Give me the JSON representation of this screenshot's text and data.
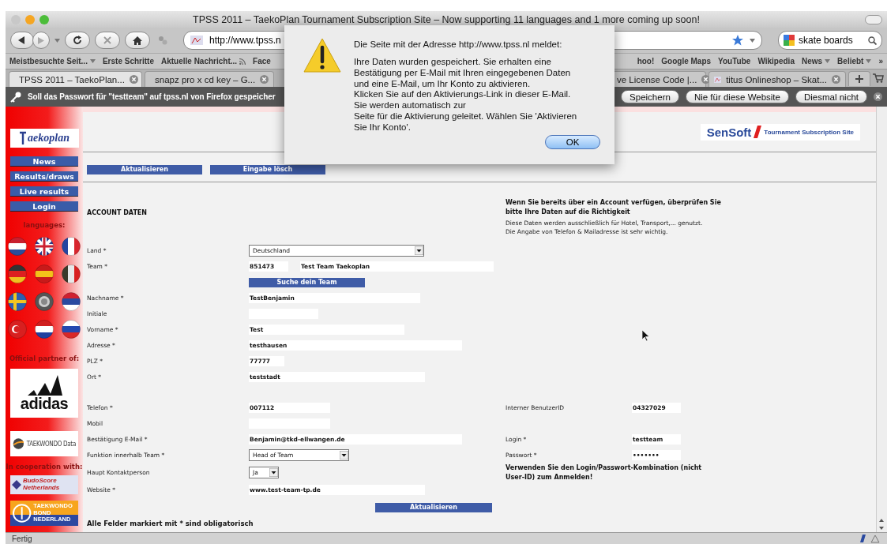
{
  "window": {
    "title": "TPSS 2011 – TaekoPlan Tournament Subscription Site – Now supporting 11 languages and 1 more coming up soon!"
  },
  "toolbar": {
    "url": "http://www.tpss.n",
    "search": {
      "value": "skate boards"
    }
  },
  "bookmarks_left": [
    {
      "label": "Meistbesuchte Seit...",
      "kind": "menu"
    },
    {
      "label": "Erste Schritte",
      "kind": "link"
    },
    {
      "label": "Aktuelle Nachricht...",
      "kind": "feed"
    },
    {
      "label": "Face",
      "kind": "link"
    }
  ],
  "bookmarks_right": [
    {
      "label": "hoo!",
      "kind": "link"
    },
    {
      "label": "Google Maps",
      "kind": "link"
    },
    {
      "label": "YouTube",
      "kind": "link"
    },
    {
      "label": "Wikipedia",
      "kind": "link"
    },
    {
      "label": "News",
      "kind": "menu"
    },
    {
      "label": "Beliebt",
      "kind": "menu"
    },
    {
      "label": "»",
      "kind": "link"
    }
  ],
  "tabs_left": [
    {
      "label": "TPSS 2011 – TaekoPlan...",
      "selected": true
    },
    {
      "label": "snapz pro x cd key – G...",
      "selected": false
    }
  ],
  "tabs_right": [
    {
      "label": "ve License Code |...",
      "selected": false
    },
    {
      "label": "titus Onlineshop – Skat...",
      "selected": false
    }
  ],
  "password_bar": {
    "message": "Soll das Passwort für \"testteam\" auf tpss.nl von Firefox gespeicher",
    "buttons": [
      "Speichern",
      "Nie für diese Website",
      "Diesmal nicht"
    ]
  },
  "sidebar": {
    "logo": "aekoplan",
    "nav": [
      "News",
      "Results/draws",
      "Live results",
      "Login"
    ],
    "languages_label": "languages:",
    "partner_label": "Official partner of:",
    "partner_logos": [
      "adidas",
      "TAEKWONDO Data"
    ],
    "cooperation_label": "In cooperation with:",
    "cooperation_logos": [
      "BudoScore Netherlands",
      "TAEKWONDO BOND NEDERLAND"
    ]
  },
  "header_logo": {
    "brand": "SenSoft",
    "tagline": "Tournament Subscription Site"
  },
  "top_buttons": [
    "Aktualisieren",
    "Eingabe lösch"
  ],
  "section_title": "ACCOUNT DATEN",
  "info": {
    "heading": "Wenn Sie bereits über ein Account verfügen, überprüfen Sie\nbitte Ihre Daten auf die Richtigkeit",
    "text": "Diese Daten werden ausschließlich für Hotel, Transport,... genutzt.\nDie Angabe von Telefon & Mailadresse ist sehr wichtig."
  },
  "address_rows": [
    {
      "label": "Land *",
      "kind": "select",
      "value": "Deutschland"
    },
    {
      "label": "Team *",
      "kind": "pair",
      "values": [
        "851473",
        "Test Team Taekoplan"
      ]
    },
    {
      "kind": "button",
      "value": "Suche dein Team"
    },
    {
      "label": "Nachname *",
      "kind": "text",
      "value": "TestBenjamin"
    },
    {
      "label": "Initiale",
      "kind": "text"
    },
    {
      "label": "Vorname *",
      "kind": "text",
      "value": "Test"
    },
    {
      "label": "Adresse *",
      "kind": "text",
      "value": "testhausen"
    },
    {
      "label": "PLZ *",
      "kind": "text",
      "value": "77777"
    },
    {
      "label": "Ort *",
      "kind": "text",
      "value": "teststadt"
    }
  ],
  "contact_rows": [
    {
      "label": "Telefon *",
      "kind": "text",
      "value": "007112",
      "side": {
        "label": "Interner BenutzerID",
        "value": "04327029"
      }
    },
    {
      "label": "Mobil",
      "kind": "text"
    },
    {
      "label": "Bestätigung E-Mail *",
      "kind": "text",
      "value": "Benjamin@tkd-ellwangen.de",
      "side": {
        "label": "Login *",
        "value": "testteam"
      }
    },
    {
      "label": "Funktion innerhalb Team *",
      "kind": "select",
      "value": "Head of Team",
      "side": {
        "label": "Passwort *",
        "value": "•••••••"
      }
    },
    {
      "label": "Haupt Kontaktperson",
      "kind": "select",
      "value": "Ja",
      "side": {
        "note": "Verwenden Sie den Login/Passwort-Kombination (nicht\nUser-ID) zum Anmelden!"
      }
    },
    {
      "label": "Website *",
      "kind": "text",
      "value": "www.test-team-tp.de"
    }
  ],
  "update_button": "Aktualisieren",
  "footnote": "Alle Felder markiert mit * sind obligatorisch",
  "status_bar": {
    "text": "Fertig"
  },
  "dialog": {
    "title": "Die Seite mit der Adresse http://www.tpss.nl meldet:",
    "message": "Ihre Daten wurden gespeichert. Sie erhalten eine\nBestätigung per E-Mail mit Ihren eingegebenen Daten\nund eine E-Mail, um Ihr Konto zu aktivieren.\nKlicken Sie auf den Aktivierungs-Link in dieser E-Mail.\nSie werden automatisch zur\nSeite für die Aktivierung geleitet. Wählen Sie 'Aktivieren\nSie Ihr Konto'.",
    "button": "OK"
  }
}
